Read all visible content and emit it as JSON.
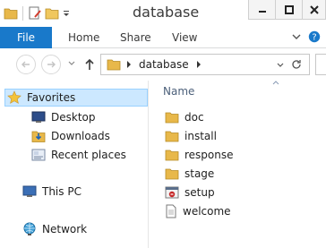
{
  "window": {
    "title": "database",
    "buttons": {
      "minimize": "minimize",
      "maximize": "maximize",
      "close": "close"
    }
  },
  "qat": {
    "icons": [
      "folder-icon",
      "properties-icon",
      "new-folder-icon",
      "customize-dropdown-icon"
    ]
  },
  "ribbon": {
    "tabs": [
      {
        "label": "File",
        "active": true
      },
      {
        "label": "Home"
      },
      {
        "label": "Share"
      },
      {
        "label": "View"
      }
    ]
  },
  "address": {
    "path": [
      "database"
    ]
  },
  "nav": {
    "favorites": {
      "label": "Favorites"
    },
    "favorite_items": [
      {
        "label": "Desktop",
        "icon": "desktop-icon"
      },
      {
        "label": "Downloads",
        "icon": "downloads-icon"
      },
      {
        "label": "Recent places",
        "icon": "recent-places-icon"
      }
    ],
    "this_pc": {
      "label": "This PC"
    },
    "network": {
      "label": "Network"
    }
  },
  "files": {
    "column_name": "Name",
    "items": [
      {
        "name": "doc",
        "type": "folder"
      },
      {
        "name": "install",
        "type": "folder"
      },
      {
        "name": "response",
        "type": "folder"
      },
      {
        "name": "stage",
        "type": "folder"
      },
      {
        "name": "setup",
        "type": "application"
      },
      {
        "name": "welcome",
        "type": "document"
      }
    ]
  },
  "colors": {
    "accent": "#1979ca",
    "selection_bg": "#cce8ff",
    "folder": "#e8b84a"
  }
}
